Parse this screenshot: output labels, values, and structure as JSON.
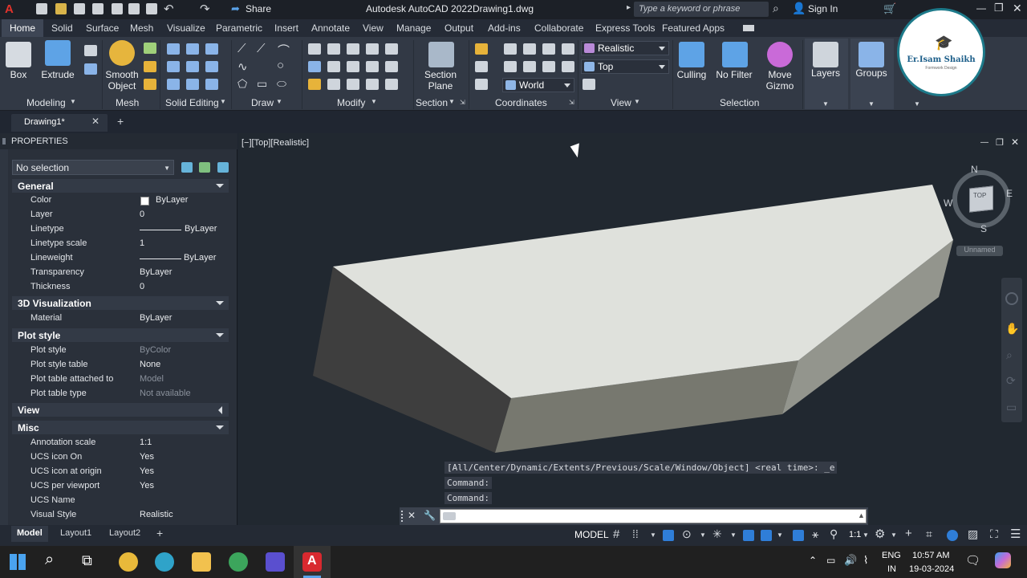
{
  "title_bar": {
    "app_title": "Autodesk AutoCAD 2022",
    "file_name": "Drawing1.dwg",
    "share_label": "Share",
    "search_placeholder": "Type a keyword or phrase",
    "sign_in": "Sign In"
  },
  "ribbon_tabs": [
    "Home",
    "Solid",
    "Surface",
    "Mesh",
    "Visualize",
    "Parametric",
    "Insert",
    "Annotate",
    "View",
    "Manage",
    "Output",
    "Add-ins",
    "Collaborate",
    "Express Tools",
    "Featured Apps"
  ],
  "active_tab": "Home",
  "ribbon": {
    "modeling": {
      "box": "Box",
      "extrude": "Extrude",
      "footer": "Modeling"
    },
    "mesh": {
      "smooth_object": [
        "Smooth",
        "Object"
      ],
      "footer": "Mesh"
    },
    "solid_editing": {
      "footer": "Solid Editing"
    },
    "draw": {
      "footer": "Draw"
    },
    "modify": {
      "footer": "Modify"
    },
    "section": {
      "section_plane": [
        "Section",
        "Plane"
      ],
      "footer": "Section"
    },
    "coordinates": {
      "footer": "Coordinates",
      "world": "World"
    },
    "view": {
      "visual_style": "Realistic",
      "view_direction": "Top",
      "footer": "View"
    },
    "selection": {
      "culling": "Culling",
      "no_filter": "No Filter",
      "move_gizmo": [
        "Move",
        "Gizmo"
      ],
      "footer": "Selection"
    },
    "layers": "Layers",
    "groups": "Groups"
  },
  "logo": {
    "name": "Er.Isam Shaikh",
    "tagline": "Formwork Design"
  },
  "file_tabs": {
    "active": "Drawing1*"
  },
  "properties": {
    "title": "PROPERTIES",
    "selection": "No selection",
    "sections": [
      {
        "name": "General",
        "rows": [
          {
            "k": "Color",
            "v": "ByLayer"
          },
          {
            "k": "Layer",
            "v": "0"
          },
          {
            "k": "Linetype",
            "v": "ByLayer"
          },
          {
            "k": "Linetype scale",
            "v": "1"
          },
          {
            "k": "Lineweight",
            "v": "ByLayer"
          },
          {
            "k": "Transparency",
            "v": "ByLayer"
          },
          {
            "k": "Thickness",
            "v": "0"
          }
        ]
      },
      {
        "name": "3D Visualization",
        "rows": [
          {
            "k": "Material",
            "v": "ByLayer"
          }
        ]
      },
      {
        "name": "Plot style",
        "rows": [
          {
            "k": "Plot style",
            "v": "ByColor"
          },
          {
            "k": "Plot style table",
            "v": "None"
          },
          {
            "k": "Plot table attached to",
            "v": "Model"
          },
          {
            "k": "Plot table type",
            "v": "Not available"
          }
        ]
      },
      {
        "name": "View",
        "rows": []
      },
      {
        "name": "Misc",
        "rows": [
          {
            "k": "Annotation scale",
            "v": "1:1"
          },
          {
            "k": "UCS icon On",
            "v": "Yes"
          },
          {
            "k": "UCS icon at origin",
            "v": "Yes"
          },
          {
            "k": "UCS per viewport",
            "v": "Yes"
          },
          {
            "k": "UCS Name",
            "v": ""
          },
          {
            "k": "Visual Style",
            "v": "Realistic"
          }
        ]
      }
    ]
  },
  "viewport": {
    "label": "[−][Top][Realistic]",
    "viewcube": {
      "n": "N",
      "s": "S",
      "e": "E",
      "w": "W",
      "face": "TOP",
      "ucs": "Unnamed"
    }
  },
  "command": {
    "history": [
      "[All/Center/Dynamic/Extents/Previous/Scale/Window/Object] <real time>: _e",
      "Command:",
      "Command:"
    ]
  },
  "layout_tabs": [
    "Model",
    "Layout1",
    "Layout2"
  ],
  "status": {
    "model": "MODEL",
    "scale": "1:1"
  },
  "taskbar": {
    "lang1": "ENG",
    "lang2": "IN",
    "time": "10:57 AM",
    "date": "19-03-2024"
  }
}
